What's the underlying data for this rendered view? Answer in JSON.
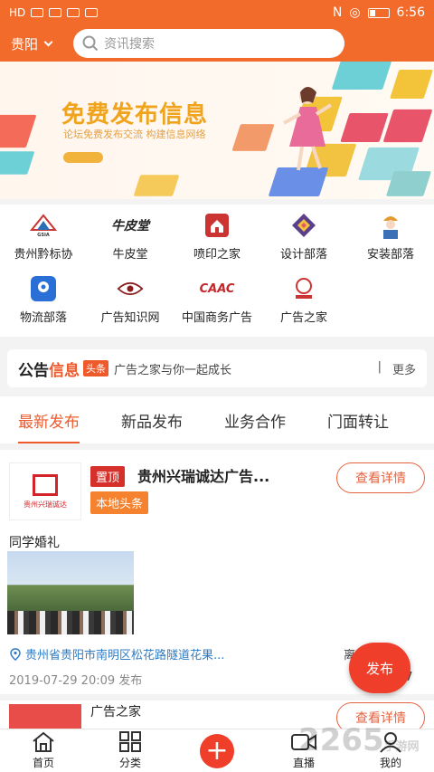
{
  "status_bar": {
    "time": "6:56",
    "carrier": "HD"
  },
  "header": {
    "city": "贵阳",
    "search_placeholder": "资讯搜索"
  },
  "banner": {
    "title": "免费发布信息",
    "subtitle": "论坛免费发布交流  构建信息网络"
  },
  "grid": [
    {
      "label": "贵州黔标协",
      "icon": "gsia-logo-icon",
      "color": "#c33"
    },
    {
      "label": "牛皮堂",
      "icon": "niupitang-logo-icon",
      "color": "#222"
    },
    {
      "label": "喷印之家",
      "icon": "penyin-home-icon",
      "color": "#c33"
    },
    {
      "label": "设计部落",
      "icon": "design-diamond-icon",
      "color": "#5b3f8c"
    },
    {
      "label": "安装部落",
      "icon": "worker-icon",
      "color": "#e59a2e"
    },
    {
      "label": "物流部落",
      "icon": "location-pin-icon",
      "color": "#2a6fd6"
    },
    {
      "label": "广告知识网",
      "icon": "eye-icon",
      "color": "#8a1e1e"
    },
    {
      "label": "中国商务广告",
      "icon": "caac-logo-icon",
      "color": "#c3282c"
    },
    {
      "label": "广告之家",
      "icon": "ad-home-logo-icon",
      "color": "#c33"
    }
  ],
  "grid_caac_text": "CAAC",
  "notice": {
    "title_a": "公告",
    "title_b": "信息",
    "tag": "头条",
    "text": "广告之家与你一起成长",
    "more": "更多"
  },
  "tabs": [
    "最新发布",
    "新品发布",
    "业务合作",
    "门面转让"
  ],
  "post": {
    "badge_top": "置顶",
    "title": "贵州兴瑞诚达广告...",
    "badge_local": "本地头条",
    "detail_button": "查看详情",
    "logo_text": "贵州兴瑞诚达",
    "text": "同学婚礼",
    "address": "贵州省贵阳市南明区松花路隧道花果...",
    "distance": "离你5km",
    "time": "2019-07-29 20:09 发布",
    "count": "27"
  },
  "post2": {
    "title": "广告之家",
    "detail_button": "查看详情"
  },
  "fab": "发布",
  "bottom_nav": [
    "首页",
    "分类",
    "",
    "直播",
    "我的"
  ],
  "watermark": {
    "main": "2265",
    "sub": "手游网"
  }
}
